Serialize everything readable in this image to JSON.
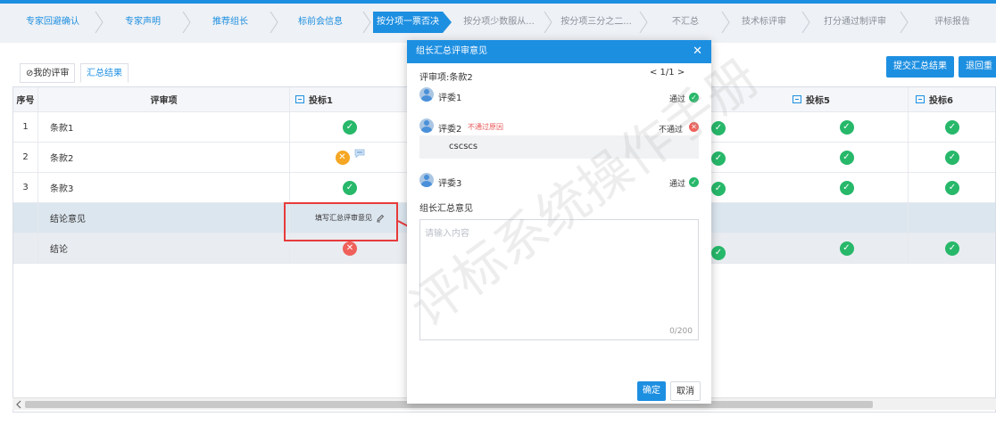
{
  "steps": [
    {
      "label": "专家回避确认",
      "state": "done"
    },
    {
      "label": "专家声明",
      "state": "done"
    },
    {
      "label": "推荐组长",
      "state": "done"
    },
    {
      "label": "标前会信息",
      "state": "done"
    },
    {
      "label": "按分项一票否决",
      "state": "active"
    },
    {
      "label": "按分项少数服从...",
      "state": "todo"
    },
    {
      "label": "按分项三分之二...",
      "state": "todo"
    },
    {
      "label": "不汇总",
      "state": "todo"
    },
    {
      "label": "技术标评审",
      "state": "todo"
    },
    {
      "label": "打分通过制评审",
      "state": "todo"
    },
    {
      "label": "评标报告",
      "state": "todo"
    }
  ],
  "tabs": {
    "mine": "⊘我的评审",
    "summary": "汇总结果"
  },
  "actions": {
    "submit": "提交汇总结果",
    "back": "退回重"
  },
  "table": {
    "headers": {
      "no": "序号",
      "item": "评审项",
      "bid1": "投标1",
      "bid5": "投标5",
      "bid6": "投标6"
    },
    "rows": [
      {
        "no": "1",
        "item": "条款1"
      },
      {
        "no": "2",
        "item": "条款2"
      },
      {
        "no": "3",
        "item": "条款3"
      }
    ],
    "opinion_label": "结论意见",
    "opinion_action": "填写汇总评审意见",
    "conclusion_label": "结论"
  },
  "modal": {
    "title": "组长汇总评审意见",
    "item_label": "评审项:条款2",
    "pager": "< 1/1 >",
    "reviewers": [
      {
        "name": "评委1",
        "note": "",
        "result": "通过",
        "status": "pass"
      },
      {
        "name": "评委2",
        "note": "不通过原因",
        "result": "不通过",
        "status": "fail"
      },
      {
        "name": "评委3",
        "note": "",
        "result": "通过",
        "status": "pass"
      }
    ],
    "reason_text": "cscscs",
    "summary_label": "组长汇总意见",
    "placeholder": "请输入内容",
    "counter": "0/200",
    "confirm": "确定",
    "cancel": "取消"
  },
  "watermark": "评标系统操作手册",
  "colors": {
    "accent": "#1d8fe1",
    "pass": "#27b86a",
    "warn": "#f5a623",
    "fail": "#f0605a",
    "annotation": "#e83b3b"
  }
}
